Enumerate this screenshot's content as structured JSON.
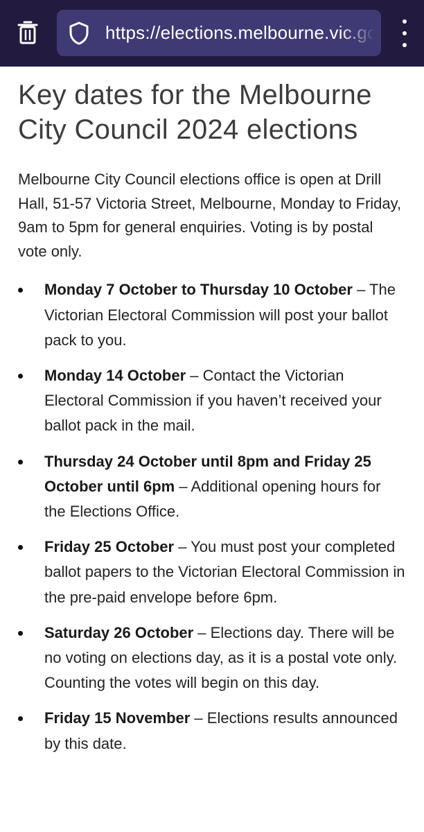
{
  "browser": {
    "url": "https://elections.melbourne.vic.gov.au",
    "icons": {
      "trash": "trash-icon",
      "shield": "shield-icon",
      "menu": "more-vertical-icon"
    }
  },
  "page": {
    "title": "Key dates for the Melbourne City Council 2024 elections",
    "intro": "Melbourne City Council elections office is open at Drill Hall, 51-57 Victoria Street, Melbourne, Monday to Friday, 9am to 5pm for general enquiries. Voting is by postal vote only.",
    "dates": [
      {
        "date": "Monday 7 October to Thursday 10 October",
        "text": " – The Victorian Electoral Commission will post your ballot pack to you."
      },
      {
        "date": "Monday 14 October",
        "text": " – Contact the Victorian Electoral Commission if you haven’t received your ballot pack in the mail."
      },
      {
        "date": "Thursday 24 October until 8pm and Friday 25 October until 6pm",
        "text": " – Additional opening hours for the Elections Office."
      },
      {
        "date": "Friday 25 October",
        "text": " – You must post your completed ballot papers to the Victorian Electoral Commission in the pre-paid envelope before 6pm."
      },
      {
        "date": "Saturday 26 October",
        "text": " – Elections day. There will be no voting on elections day, as it is a postal vote only. Counting the votes will begin on this day."
      },
      {
        "date": "Friday 15 November",
        "text": " – Elections results announced by this date."
      }
    ]
  }
}
